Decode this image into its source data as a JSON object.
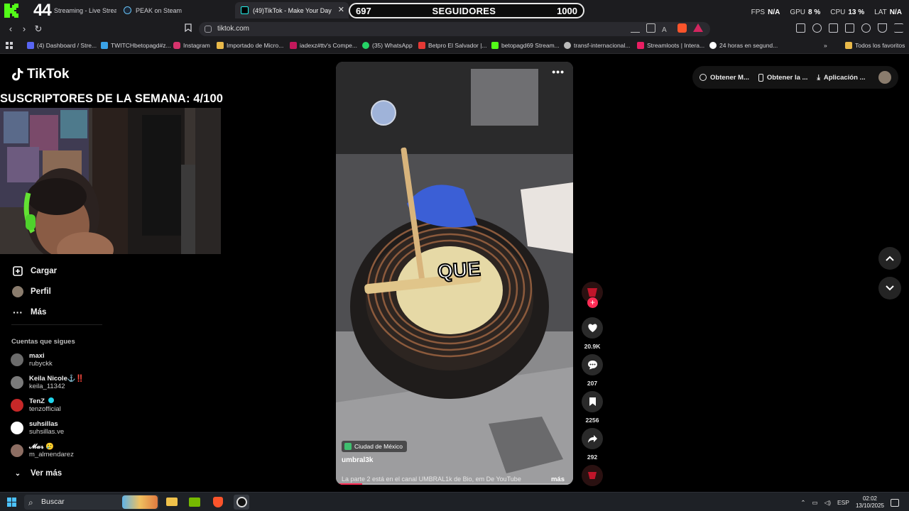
{
  "colors": {
    "tiktok_red": "#fe2c55",
    "kick_green": "#53fc18",
    "browser_bg": "#1c1c1f",
    "page_bg": "#000000"
  },
  "browser": {
    "stream_counter": "44",
    "tabs": [
      {
        "label": "Streaming - Live Stream",
        "icon": "kick-icon"
      },
      {
        "label": "PEAK on Steam",
        "icon": "steam-icon"
      },
      {
        "label": "(49)TikTok - Make Your Day",
        "icon": "tiktok-icon",
        "active": true
      }
    ],
    "url": "tiktok.com",
    "bookmarks": [
      {
        "label": "(4) Dashboard / Stre...",
        "icon": "discord-icon",
        "color": "#5865f2"
      },
      {
        "label": "TWITCHbetopagd#z...",
        "icon": "bookmark-icon",
        "color": "#3aa3e8"
      },
      {
        "label": "Instagram",
        "icon": "instagram-icon",
        "color": "#d6336c"
      },
      {
        "label": "Importado de Micro...",
        "icon": "folder-icon",
        "color": "#e9b949"
      },
      {
        "label": "iadexz#ttv's Compe...",
        "icon": "bookmark-icon",
        "color": "#c2185b"
      },
      {
        "label": "(35) WhatsApp",
        "icon": "whatsapp-icon",
        "color": "#25d366"
      },
      {
        "label": "Betpro El Salvador |...",
        "icon": "bookmark-icon",
        "color": "#e53935"
      },
      {
        "label": "betopagd69 Stream...",
        "icon": "kick-icon",
        "color": "#53fc18"
      },
      {
        "label": "transf-internacional...",
        "icon": "globe-icon",
        "color": "#bbbbbb"
      },
      {
        "label": "Streamloots | Intera...",
        "icon": "bookmark-icon",
        "color": "#e91e63"
      },
      {
        "label": "24 horas en segund...",
        "icon": "google-icon",
        "color": "#ffffff"
      }
    ],
    "all_favorites": "Todos los favoritos"
  },
  "overlay": {
    "followers_current": "697",
    "followers_label": "SEGUIDORES",
    "followers_goal": "1000",
    "stats": [
      {
        "label": "FPS",
        "value": "N/A"
      },
      {
        "label": "GPU",
        "value": "8 %"
      },
      {
        "label": "CPU",
        "value": "13 %"
      },
      {
        "label": "LAT",
        "value": "N/A"
      }
    ],
    "subs_banner": "SUSCRIPTORES DE LA SEMANA: 4/100"
  },
  "tiktok": {
    "logo_text": "TikTok",
    "nav": [
      {
        "label": "Cargar",
        "icon": "upload-icon"
      },
      {
        "label": "Perfil",
        "icon": "profile-icon"
      },
      {
        "label": "Más",
        "icon": "more-icon"
      }
    ],
    "following_title": "Cuentas que sigues",
    "following": [
      {
        "name": "maxi",
        "handle": "rubyckk",
        "color": "#6b6b6b"
      },
      {
        "name": "Keila Nicole⚓‼️",
        "handle": "keila_11342",
        "color": "#7a7a7a"
      },
      {
        "name": "TenZ",
        "handle": "tenzofficial",
        "color": "#c62828",
        "verified": true
      },
      {
        "name": "suhsillas",
        "handle": "suhsillas.ve",
        "color": "#ffffff"
      },
      {
        "name": "𝓜𝓪𝓻 🥲",
        "handle": "m_almendarez",
        "color": "#8d6e63"
      }
    ],
    "see_more": "Ver más",
    "top_bar": [
      {
        "label": "Obtener M...",
        "icon": "coin-icon"
      },
      {
        "label": "Obtener la ...",
        "icon": "phone-icon"
      },
      {
        "label": "Aplicación ...",
        "icon": "download-icon"
      }
    ],
    "video": {
      "caption_word": "QUE",
      "location": "Ciudad de México",
      "author": "umbral3k",
      "description": "La parte 2 está en el canal UMBRAL1k de Bio, em De YouTube",
      "more": "más",
      "progress": 0.11
    },
    "actions": {
      "likes": "20.9K",
      "comments": "207",
      "saves": "2256",
      "shares": "292"
    }
  },
  "taskbar": {
    "search_placeholder": "Buscar",
    "language": "ESP",
    "time": "02:02",
    "date": "13/10/2025"
  }
}
